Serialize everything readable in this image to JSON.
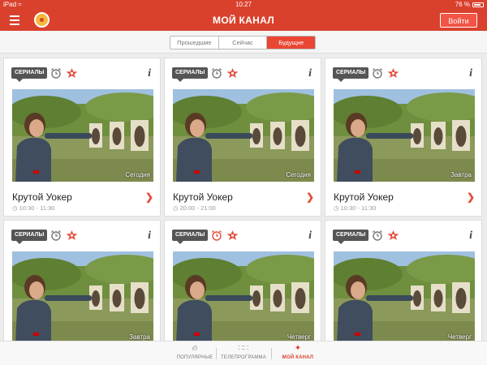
{
  "status_bar": {
    "carrier": "iPad",
    "wifi_icon": "wifi-icon",
    "time": "10:27",
    "battery_percent": "76 %"
  },
  "header": {
    "title": "МОЙ КАНАЛ",
    "login_label": "Войти",
    "menu_icon": "hamburger-icon",
    "logo_icon": "app-logo"
  },
  "segments": {
    "items": [
      "Прошедшие",
      "Сейчас",
      "Будущие"
    ],
    "active_index": 2
  },
  "cards": [
    {
      "category": "СЕРИАЛЫ",
      "day": "Сегодня",
      "title": "Крутой Уокер",
      "time": "10:30 - 11:30",
      "alarm_active": false
    },
    {
      "category": "СЕРИАЛЫ",
      "day": "Сегодня",
      "title": "Крутой Уокер",
      "time": "20:00 - 21:00",
      "alarm_active": false
    },
    {
      "category": "СЕРИАЛЫ",
      "day": "Завтра",
      "title": "Крутой Уокер",
      "time": "10:30 - 11:30",
      "alarm_active": false
    },
    {
      "category": "СЕРИАЛЫ",
      "day": "Завтра",
      "title": "",
      "time": "",
      "alarm_active": false
    },
    {
      "category": "СЕРИАЛЫ",
      "day": "Четверг",
      "title": "",
      "time": "",
      "alarm_active": true
    },
    {
      "category": "СЕРИАЛЫ",
      "day": "Четверг",
      "title": "",
      "time": "",
      "alarm_active": false
    }
  ],
  "tabbar": {
    "tabs": [
      {
        "label": "ПОПУЛЯРНЫЕ",
        "icon": "flame-icon"
      },
      {
        "label": "ТЕЛЕПРОГРАММА",
        "icon": "grid-icon"
      },
      {
        "label": "МОЙ КАНАЛ",
        "icon": "star-icon"
      }
    ],
    "active_index": 2
  },
  "colors": {
    "accent": "#d9412d",
    "active_segment": "#ea4634",
    "arrow": "#e44c3a"
  }
}
